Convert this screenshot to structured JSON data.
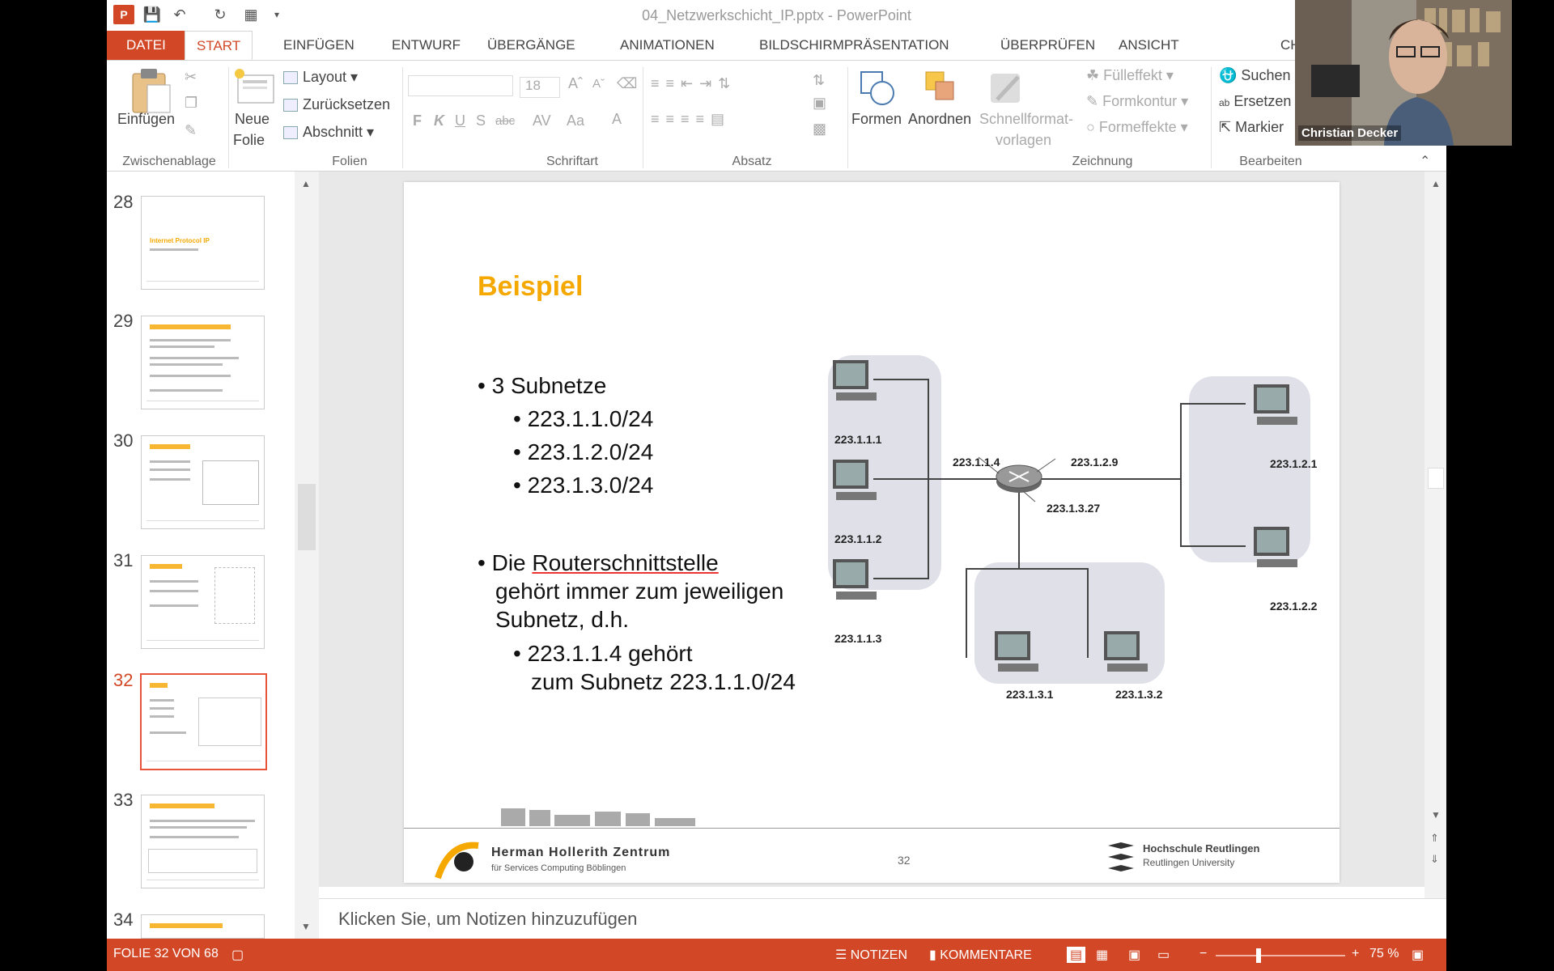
{
  "window": {
    "title": "04_Netzwerkschicht_IP.pptx - PowerPoint"
  },
  "ribbon_tabs": [
    {
      "label": "DATEI"
    },
    {
      "label": "START"
    },
    {
      "label": "EINFÜGEN"
    },
    {
      "label": "ENTWURF"
    },
    {
      "label": "ÜBERGÄNGE"
    },
    {
      "label": "ANIMATIONEN"
    },
    {
      "label": "BILDSCHIRMPRÄSENTATION"
    },
    {
      "label": "ÜBERPRÜFEN"
    },
    {
      "label": "ANSICHT"
    },
    {
      "label": "CH"
    }
  ],
  "ribbon": {
    "clipboard": {
      "paste": "Einfügen",
      "group": "Zwischenablage"
    },
    "slides": {
      "new_line1": "Neue",
      "new_line2": "Folie",
      "layout": "Layout",
      "reset": "Zurücksetzen",
      "section": "Abschnitt",
      "group": "Folien"
    },
    "font": {
      "size": "18",
      "group": "Schriftart",
      "bold": "F",
      "italic": "K",
      "underline": "U",
      "shadow": "S",
      "strike": "abc",
      "spacing": "AV",
      "case": "Aa"
    },
    "paragraph": {
      "group": "Absatz"
    },
    "drawing": {
      "shapes": "Formen",
      "arrange": "Anordnen",
      "quickstyles1": "Schnellformat-",
      "quickstyles2": "vorlagen",
      "fill": "Fülleffekt",
      "outline": "Formkontur",
      "effects": "Formeffekte",
      "group": "Zeichnung"
    },
    "editing": {
      "find": "Suchen",
      "replace": "Ersetzen",
      "select": "Markier",
      "group": "Bearbeiten"
    }
  },
  "thumbnails": [
    {
      "num": "28",
      "title": "Internet Protocol IP"
    },
    {
      "num": "29"
    },
    {
      "num": "30"
    },
    {
      "num": "31"
    },
    {
      "num": "32"
    },
    {
      "num": "33"
    },
    {
      "num": "34"
    }
  ],
  "slide": {
    "title": "Beispiel",
    "bullet1": "3 Subnetze",
    "sub1": "223.1.1.0/24",
    "sub2": "223.1.2.0/24",
    "sub3": "223.1.3.0/24",
    "bullet2_pre": "Die ",
    "bullet2_link": "Routerschnittstelle",
    "bullet2_line2": "gehört immer zum jeweiligen",
    "bullet2_line3": "Subnetz, d.h.",
    "sub4_line1": "223.1.1.4 gehört",
    "sub4_line2": "zum Subnetz 223.1.1.0/24",
    "hosts": {
      "h111": "223.1.1.1",
      "h112": "223.1.1.2",
      "h113": "223.1.1.3",
      "h114": "223.1.1.4",
      "h129": "223.1.2.9",
      "h1327": "223.1.3.27",
      "h121": "223.1.2.1",
      "h122": "223.1.2.2",
      "h131": "223.1.3.1",
      "h132": "223.1.3.2"
    },
    "footer": {
      "org1": "Herman Hollerith Zentrum",
      "org2": "für Services Computing Böblingen",
      "page": "32",
      "uni1": "Hochschule Reutlingen",
      "uni2": "Reutlingen University"
    }
  },
  "notes": {
    "placeholder": "Klicken Sie, um Notizen hinzuzufügen"
  },
  "status": {
    "slide_info": "FOLIE 32 VON 68",
    "notes": "NOTIZEN",
    "comments": "KOMMENTARE",
    "zoom": "75 %"
  },
  "webcam": {
    "name": "Christian Decker"
  },
  "colors": {
    "accent": "#d24726",
    "title_orange": "#f5a800"
  }
}
